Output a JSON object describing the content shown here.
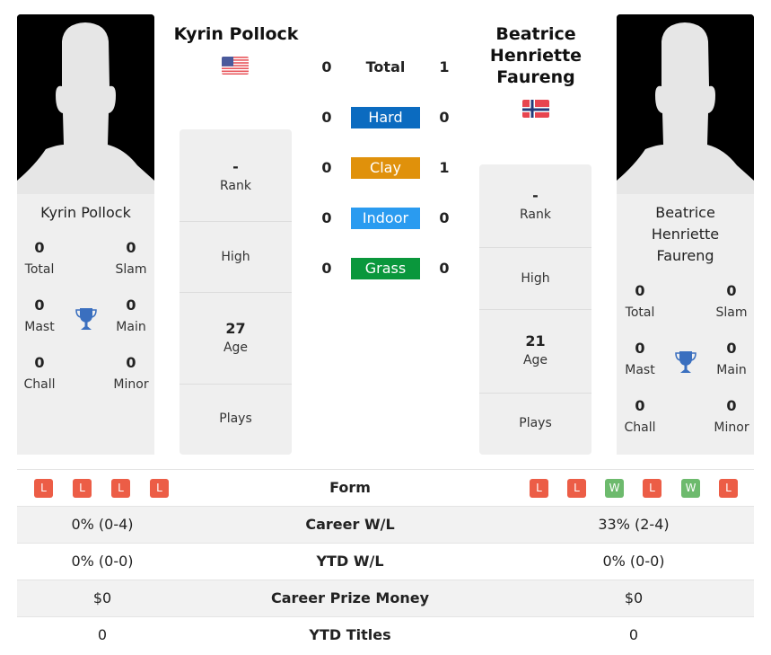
{
  "colors": {
    "hard": "#0b6bc0",
    "clay": "#e0910b",
    "indoor": "#2a9bf0",
    "grass": "#0a973c",
    "loss_badge": "#ec5d46",
    "win_badge": "#6dba6d",
    "trophy": "#3a6fbf"
  },
  "player1": {
    "name": "Kyrin Pollock",
    "flag": "usa-flag-icon",
    "titles": {
      "total": {
        "value": "0",
        "label": "Total"
      },
      "slam": {
        "value": "0",
        "label": "Slam"
      },
      "mast": {
        "value": "0",
        "label": "Mast"
      },
      "main": {
        "value": "0",
        "label": "Main"
      },
      "chall": {
        "value": "0",
        "label": "Chall"
      },
      "minor": {
        "value": "0",
        "label": "Minor"
      }
    },
    "stats": {
      "rank": {
        "value": "-",
        "label": "Rank"
      },
      "high": {
        "value": "",
        "label": "High"
      },
      "age": {
        "value": "27",
        "label": "Age"
      },
      "plays": {
        "value": "",
        "label": "Plays"
      }
    },
    "form": [
      "L",
      "L",
      "L",
      "L"
    ],
    "career_wl": "0% (0-4)",
    "ytd_wl": "0% (0-0)",
    "prize_money": "$0",
    "ytd_titles": "0"
  },
  "player2": {
    "name": "Beatrice Henriette Faureng",
    "name_lines": [
      "Beatrice",
      "Henriette",
      "Faureng"
    ],
    "flag": "norway-flag-icon",
    "titles": {
      "total": {
        "value": "0",
        "label": "Total"
      },
      "slam": {
        "value": "0",
        "label": "Slam"
      },
      "mast": {
        "value": "0",
        "label": "Mast"
      },
      "main": {
        "value": "0",
        "label": "Main"
      },
      "chall": {
        "value": "0",
        "label": "Chall"
      },
      "minor": {
        "value": "0",
        "label": "Minor"
      }
    },
    "stats": {
      "rank": {
        "value": "-",
        "label": "Rank"
      },
      "high": {
        "value": "",
        "label": "High"
      },
      "age": {
        "value": "21",
        "label": "Age"
      },
      "plays": {
        "value": "",
        "label": "Plays"
      }
    },
    "form": [
      "L",
      "L",
      "W",
      "L",
      "W",
      "L"
    ],
    "career_wl": "33% (2-4)",
    "ytd_wl": "0% (0-0)",
    "prize_money": "$0",
    "ytd_titles": "0"
  },
  "h2h": [
    {
      "label": "Total",
      "p1": "0",
      "p2": "1"
    },
    {
      "label": "Hard",
      "p1": "0",
      "p2": "0"
    },
    {
      "label": "Clay",
      "p1": "0",
      "p2": "1"
    },
    {
      "label": "Indoor",
      "p1": "0",
      "p2": "0"
    },
    {
      "label": "Grass",
      "p1": "0",
      "p2": "0"
    }
  ],
  "comparison": {
    "form": "Form",
    "career_wl": "Career W/L",
    "ytd_wl": "YTD W/L",
    "prize_money": "Career Prize Money",
    "ytd_titles": "YTD Titles"
  }
}
